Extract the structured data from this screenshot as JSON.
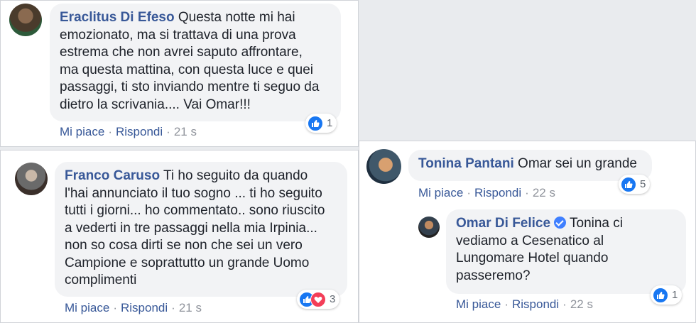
{
  "colors": {
    "name": "#385898",
    "bubble": "#f2f3f5",
    "meta": "#90949c",
    "like": "#1877f2",
    "love": "#f33e58"
  },
  "comments": [
    {
      "author": "Eraclitus Di Efeso",
      "text": "Questa notte mi hai\nemozionato, ma si trattava di una prova\nestrema che non avrei saputo affrontare,\nma questa mattina, con questa luce e quei\npassaggi, ti sto inviando mentre ti seguo da\ndietro la scrivania.... Vai Omar!!!",
      "like_label": "Mi piace",
      "reply_label": "Rispondi",
      "time": "21 s",
      "reactions": [
        "like-icon"
      ],
      "reaction_count": "1"
    },
    {
      "author": "Franco Caruso",
      "text": "Ti ho seguito da quando\nl'hai annunciato il tuo sogno ... ti ho seguito\ntutti i giorni... ho commentato.. sono riuscito\na vederti in tre passaggi nella mia Irpinia...\nnon so cosa dirti se non che sei un vero\nCampione e soprattutto un grande Uomo\ncomplimenti",
      "like_label": "Mi piace",
      "reply_label": "Rispondi",
      "time": "21 s",
      "reactions": [
        "like-icon",
        "love-icon"
      ],
      "reaction_count": "3"
    },
    {
      "author": "Tonina Pantani",
      "text": "Omar sei un grande",
      "like_label": "Mi piace",
      "reply_label": "Rispondi",
      "time": "22 s",
      "reactions": [
        "like-icon"
      ],
      "reaction_count": "5"
    },
    {
      "author": "Omar Di Felice",
      "verified": true,
      "text": "Tonina ci\nvediamo a Cesenatico al\nLungomare Hotel quando\npasseremo?",
      "like_label": "Mi piace",
      "reply_label": "Rispondi",
      "time": "22 s",
      "reactions": [
        "like-icon"
      ],
      "reaction_count": "1"
    }
  ]
}
